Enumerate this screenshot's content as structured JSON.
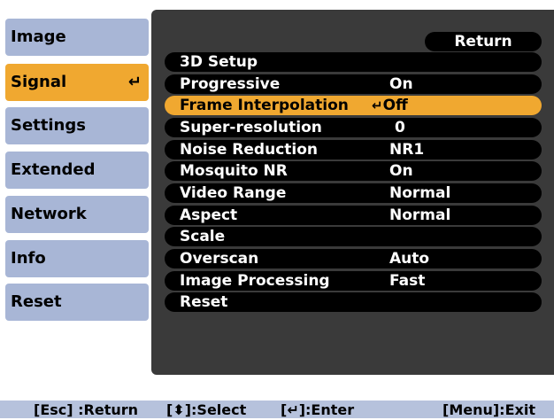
{
  "sidebar": {
    "items": [
      {
        "label": "Image"
      },
      {
        "label": "Signal",
        "glyph": "↵"
      },
      {
        "label": "Settings"
      },
      {
        "label": "Extended"
      },
      {
        "label": "Network"
      },
      {
        "label": "Info"
      },
      {
        "label": "Reset"
      }
    ],
    "active_index": 1
  },
  "panel": {
    "return_label": "Return",
    "rows": [
      {
        "label": "3D Setup",
        "value": ""
      },
      {
        "label": "Progressive",
        "value": "On"
      },
      {
        "label": "Frame Interpolation",
        "value": "Off",
        "glyph": "↵"
      },
      {
        "label": "Super-resolution",
        "value": "0"
      },
      {
        "label": "Noise Reduction",
        "value": "NR1"
      },
      {
        "label": "Mosquito NR",
        "value": "On"
      },
      {
        "label": "Video Range",
        "value": "Normal"
      },
      {
        "label": "Aspect",
        "value": "Normal"
      },
      {
        "label": "Scale",
        "value": ""
      },
      {
        "label": "Overscan",
        "value": "Auto"
      },
      {
        "label": "Image Processing",
        "value": "Fast"
      },
      {
        "label": "Reset",
        "value": ""
      }
    ],
    "selected_index": 2
  },
  "footer": {
    "esc": "[Esc] :Return",
    "select": "[⬍]:Select",
    "enter": "[↵]:Enter",
    "menu": "[Menu]:Exit"
  },
  "colors": {
    "accent": "#f0a830",
    "tab_bg": "#a8b6d6",
    "panel_bg": "#3a3a3a",
    "footer_bg": "#b6c2dc"
  }
}
